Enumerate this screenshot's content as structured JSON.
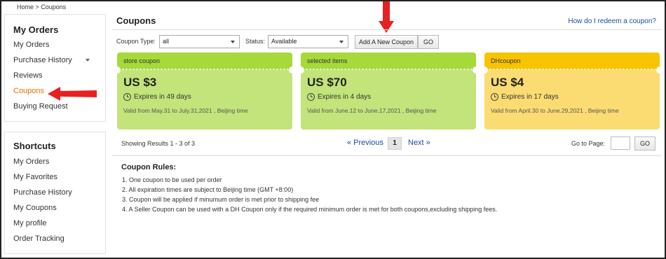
{
  "breadcrumb": "Home > Coupons",
  "sidebar": {
    "orders_title": "My Orders",
    "orders_items": [
      {
        "label": "My Orders"
      },
      {
        "label": "Purchase History"
      },
      {
        "label": "Reviews"
      },
      {
        "label": "Coupons"
      },
      {
        "label": "Buying Request"
      }
    ],
    "shortcuts_title": "Shortcuts",
    "shortcut_items": [
      {
        "label": "My Orders"
      },
      {
        "label": "My Favorites"
      },
      {
        "label": "Purchase History"
      },
      {
        "label": "My Coupons"
      },
      {
        "label": "My profile"
      },
      {
        "label": "Order Tracking"
      }
    ]
  },
  "main": {
    "title": "Coupons",
    "help_link": "How do I redeem a coupon?",
    "filters": {
      "type_label": "Coupon Type:",
      "type_value": "all",
      "status_label": "Status:",
      "status_value": "Available",
      "add_button": "Add A New Coupon",
      "go_button": "GO"
    },
    "coupons": [
      {
        "head": "store coupon",
        "amount": "US $3",
        "expires": "Expires in 49 days",
        "valid": "Valid from May.31  to July.31,2021 , Beijing time",
        "head_color": "#a6d93a",
        "body_color": "#c2e47a"
      },
      {
        "head": "selected items",
        "amount": "US $70",
        "expires": "Expires in 4 days",
        "valid": "Valid from June.12  to June.17,2021 , Beijing time",
        "head_color": "#a6d93a",
        "body_color": "#c2e47a"
      },
      {
        "head": "DHcoupon",
        "amount": "US $4",
        "expires": "Expires in 17 days",
        "valid": "Valid from April.30  to June.29,2021 , Beijing time",
        "head_color": "#f7c400",
        "body_color": "#fbdc72"
      }
    ],
    "pagination": {
      "showing": "Showing Results 1 - 3 of 3",
      "previous": "« Previous",
      "current_page": "1",
      "next": "Next »",
      "goto_label": "Go to Page:",
      "goto_button": "GO"
    },
    "rules": {
      "title": "Coupon Rules:",
      "items": [
        "1. One coupon to be used per order",
        "2. All expiration times are subject to Beijing time (GMT +8:00)",
        "3. Coupon will be applied if minumum order is met prior to shipping fee",
        "4. A Seller Coupon can be used with a DH Coupon only if the required minimum order is met for both coupons,excluding shipping fees."
      ]
    }
  },
  "annotations": {
    "arrow_color": "#e8201f"
  }
}
